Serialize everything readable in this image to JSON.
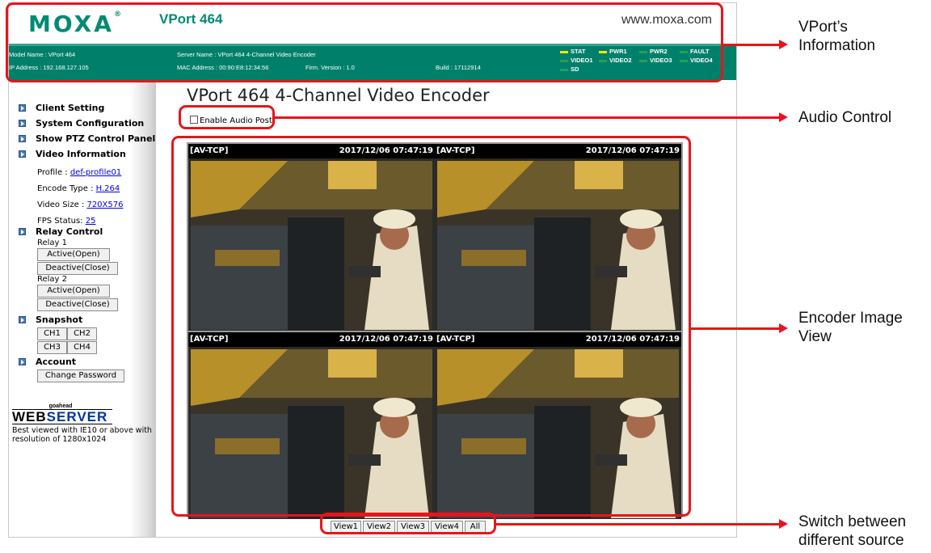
{
  "header": {
    "logo_text": "MOXA",
    "logo_mark": "®",
    "product_title": "VPort 464",
    "site_url": "www.moxa.com",
    "brand_color": "#00806b"
  },
  "info_bar": {
    "model_name": "Model Name : VPort 464",
    "ip_address": "IP Address : 192.168.127.105",
    "server_name": "Server Name : VPort 464 4-Channel Video Encoder",
    "mac_address": "MAC Address : 00:90:E8:12:34:56",
    "firmware": "Firm. Version : 1.0",
    "build": "Build : 17112914",
    "leds": [
      {
        "label": "STAT",
        "color": "#ffe600"
      },
      {
        "label": "PWR1",
        "color": "#ffe600"
      },
      {
        "label": "PWR2",
        "color": "#2a9d5a"
      },
      {
        "label": "FAULT",
        "color": "#2a9d5a"
      },
      {
        "label": "VIDEO1",
        "color": "#2a9d5a"
      },
      {
        "label": "VIDEO2",
        "color": "#2a9d5a"
      },
      {
        "label": "VIDEO3",
        "color": "#2a9d5a"
      },
      {
        "label": "VIDEO4",
        "color": "#2a9d5a"
      },
      {
        "label": "SD",
        "color": "#2a9d5a"
      }
    ]
  },
  "sidebar": {
    "client_setting": "Client Setting",
    "system_configuration": "System Configuration",
    "show_ptz": "Show PTZ Control Panel",
    "video_information": "Video Information",
    "profile_label": "Profile : ",
    "profile_value": "def-profile01",
    "encode_label": "Encode Type : ",
    "encode_value": "H.264",
    "size_label": "Video Size : ",
    "size_value": "720X576",
    "fps_label": "FPS Status: ",
    "fps_value": "25",
    "relay_control": "Relay Control",
    "relay1": "Relay 1",
    "relay2": "Relay 2",
    "active_open": "Active(Open)",
    "deactive_close": "Deactive(Close)",
    "snapshot": "Snapshot",
    "ch1": "CH1",
    "ch2": "CH2",
    "ch3": "CH3",
    "ch4": "CH4",
    "account": "Account",
    "change_password": "Change Password",
    "goahead_small": "goahead",
    "goahead_web": "WEB",
    "goahead_server": "SERVER",
    "best_viewed": "Best viewed with IE10 or above with resolution of 1280x1024"
  },
  "main": {
    "page_title": "VPort 464 4-Channel Video Encoder",
    "enable_audio": "Enable Audio Post",
    "channels": [
      {
        "protocol": "[AV-TCP]",
        "timestamp": "2017/12/06 07:47:19"
      },
      {
        "protocol": "[AV-TCP]",
        "timestamp": "2017/12/06 07:47:19"
      },
      {
        "protocol": "[AV-TCP]",
        "timestamp": "2017/12/06 07:47:19"
      },
      {
        "protocol": "[AV-TCP]",
        "timestamp": "2017/12/06 07:47:19"
      }
    ],
    "view_buttons": [
      "View1",
      "View2",
      "View3",
      "View4",
      "All"
    ]
  },
  "annotations": {
    "vport_info": [
      "VPort’s",
      "Information"
    ],
    "audio_control": "Audio Control",
    "encoder_view": [
      "Encoder Image",
      "View"
    ],
    "switch_source": [
      "Switch between",
      "different source"
    ],
    "highlight_color": "#e8141c"
  }
}
